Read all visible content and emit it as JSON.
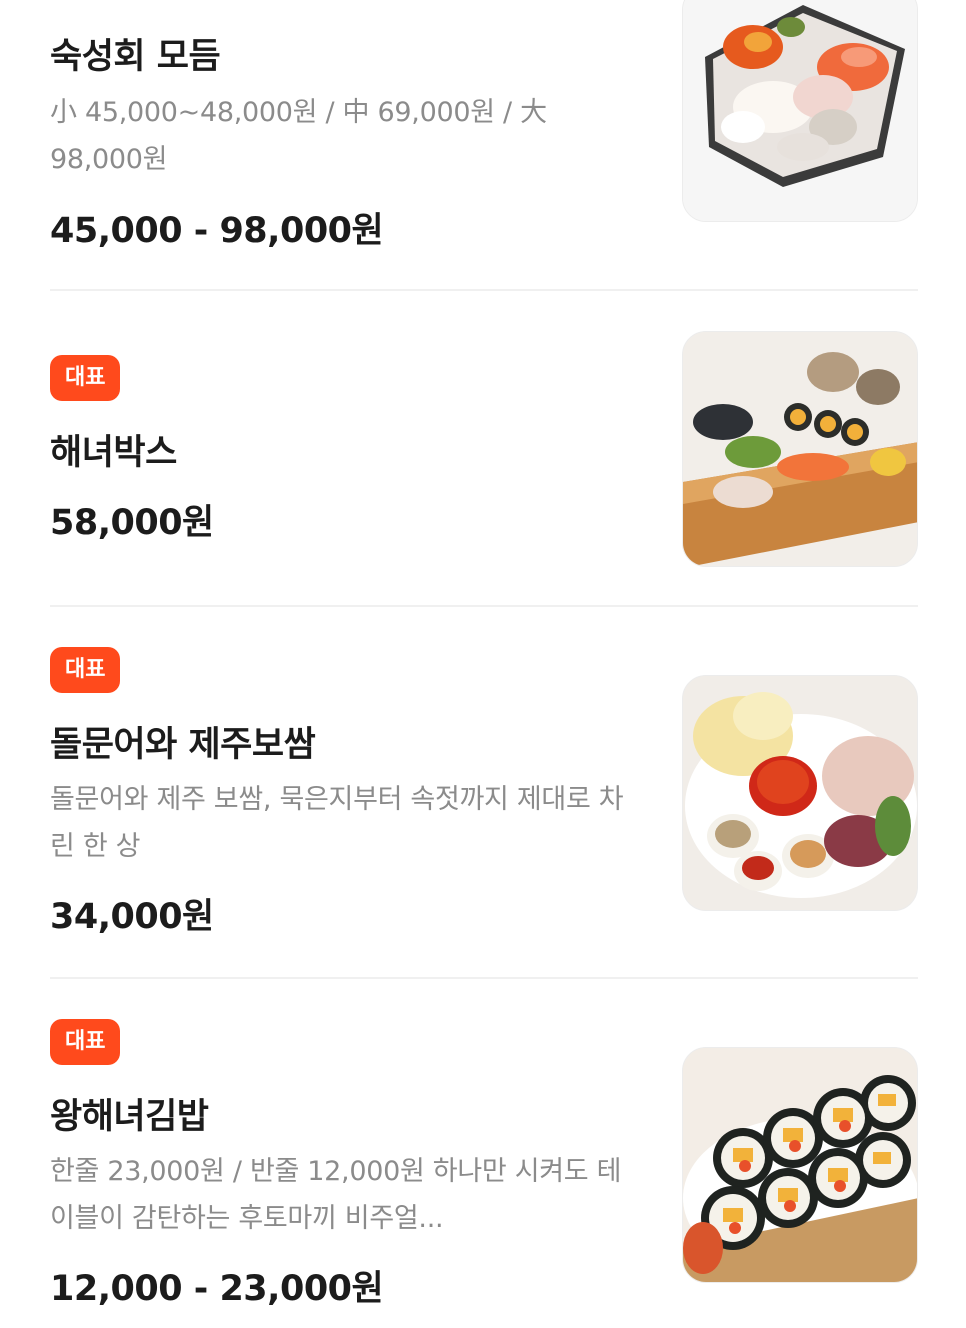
{
  "menu": {
    "items": [
      {
        "name": "숙성회 모듬",
        "description": "小 45,000~48,000원 / 中 69,000원 / 大 98,000원",
        "price": "45,000 - 98,000원",
        "image": "sashimi-platter-photo"
      },
      {
        "badge": "대표",
        "name": "해녀박스",
        "price": "58,000원",
        "image": "seafood-box-photo"
      },
      {
        "badge": "대표",
        "name": "돌문어와 제주보쌈",
        "description": "돌문어와 제주 보쌈, 묵은지부터 속젓까지 제대로 차린 한 상",
        "price": "34,000원",
        "image": "octopus-bossam-photo"
      },
      {
        "badge": "대표",
        "name": "왕해녀김밥",
        "description": "한줄 23,000원 / 반줄 12,000원 하나만 시켜도 테이블이 감탄하는 후토마끼 비주얼...",
        "price": "12,000 - 23,000원",
        "image": "gimbap-photo"
      }
    ]
  },
  "colors": {
    "badge": "#ff4a1c",
    "text_primary": "#1c1c1c",
    "text_secondary": "#8b8b8b",
    "divider": "#f0f0f0"
  }
}
